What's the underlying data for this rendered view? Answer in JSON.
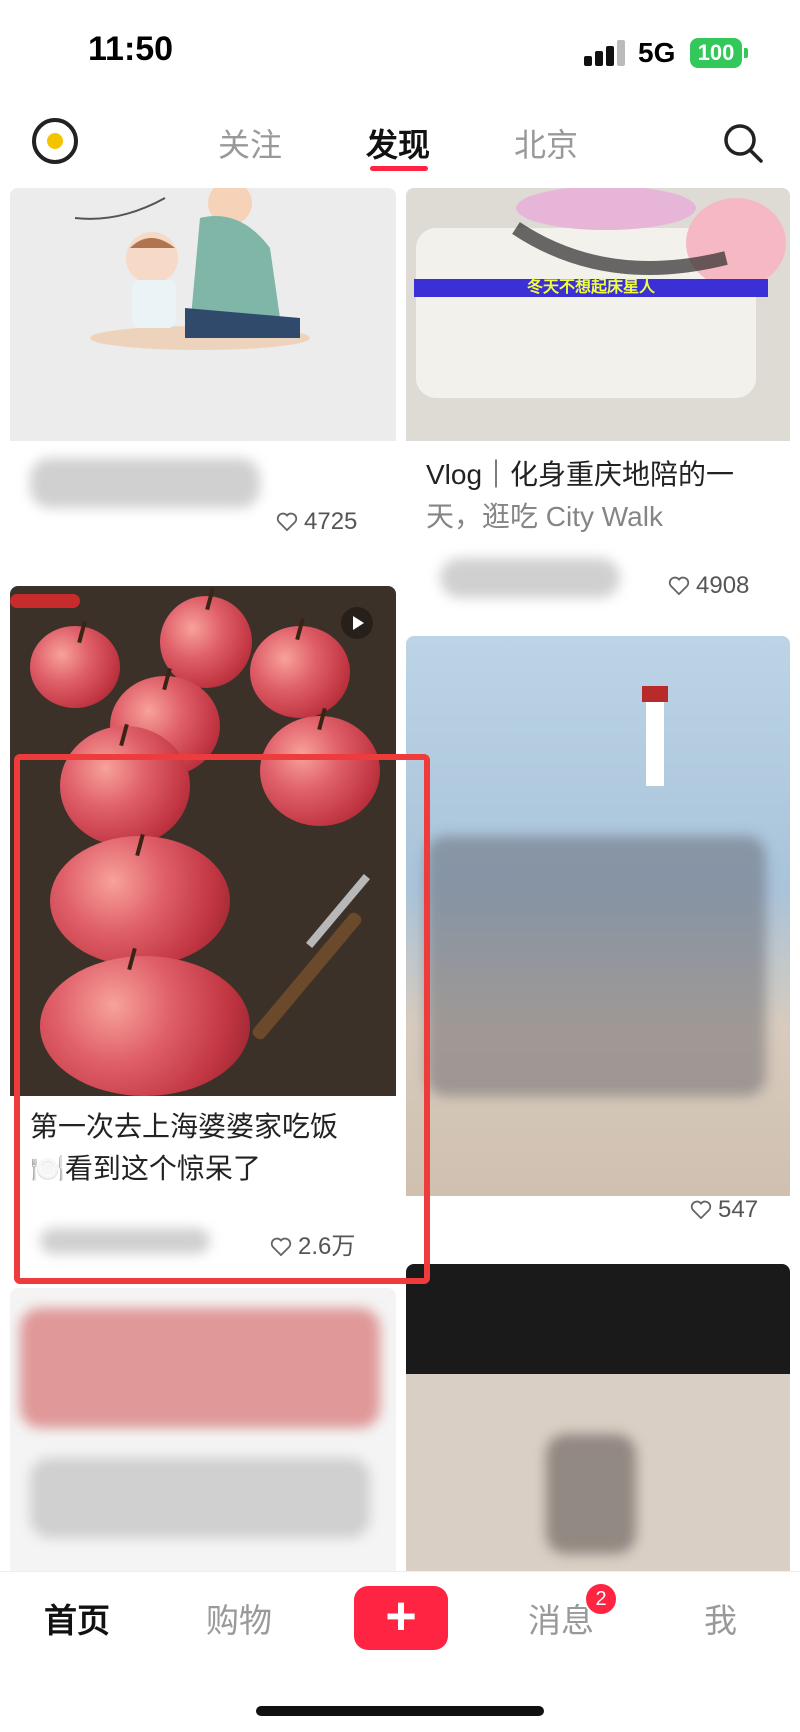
{
  "status_bar": {
    "time": "11:50",
    "network": "5G",
    "battery": "100"
  },
  "top_nav": {
    "tabs": [
      "关注",
      "发现",
      "北京"
    ],
    "active_tab": "发现"
  },
  "feed": {
    "cards": [
      {
        "id": "card-1",
        "title": "",
        "likes": "4725"
      },
      {
        "id": "card-2",
        "overlay_text": "冬天不想起床星人",
        "title": "Vlog｜化身重庆地陪的一天，逛吃 City Walk",
        "title_line1": "Vlog｜化身重庆地陪的一",
        "title_line2": "天，逛吃 City Walk",
        "likes": "4908"
      },
      {
        "id": "card-3",
        "title_line1": "第一次去上海婆婆家吃饭",
        "title_line2": "🍽️看到这个惊呆了",
        "likes": "2.6万"
      },
      {
        "id": "card-4",
        "likes": "547"
      }
    ]
  },
  "bottom_nav": {
    "items": [
      "首页",
      "购物",
      "消息",
      "我"
    ],
    "active": "首页",
    "messages_badge": "2",
    "plus_label": "+"
  },
  "colors": {
    "accent": "#ff2442",
    "battery": "#32c85a",
    "annotation": "#ee3b3b"
  },
  "icons": {
    "logo": "camera-lens-icon",
    "search": "search-icon",
    "heart": "heart-icon",
    "play": "play-icon"
  }
}
